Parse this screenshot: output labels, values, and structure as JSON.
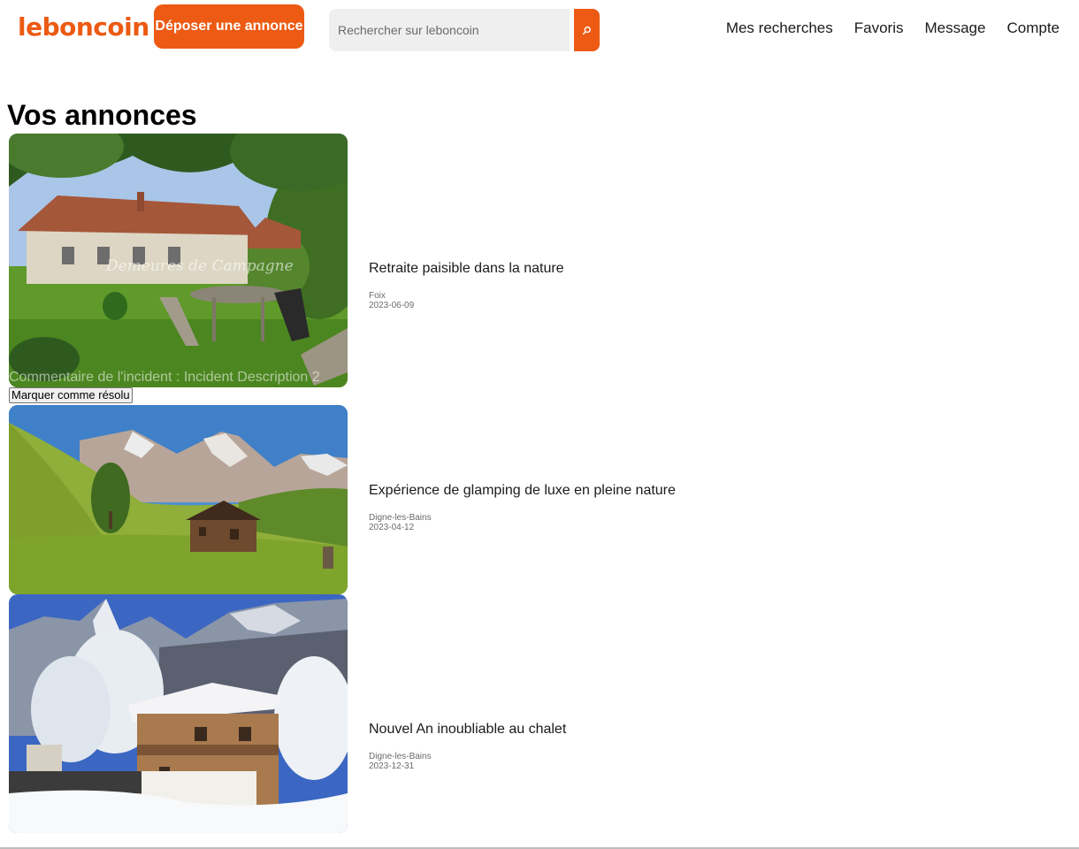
{
  "brand": {
    "logo_text": "leboncoin",
    "accent": "#ec5a13"
  },
  "header": {
    "post_button": "Déposer une annonce",
    "search": {
      "placeholder": "Rechercher sur leboncoin",
      "value": ""
    },
    "search_icon": "search-icon",
    "nav": [
      "Mes recherches",
      "Favoris",
      "Message",
      "Compte"
    ]
  },
  "main": {
    "title": "Vos annonces",
    "listings": [
      {
        "title": "Retraite paisible dans la nature",
        "location": "Foix",
        "date": "2023-06-09",
        "image": "country-house-garden",
        "watermark": "Demeures de Campagne",
        "incident_comment": "Commentaire de l'incident : Incident Description 2",
        "resolve_button": "Marquer comme résolu"
      },
      {
        "title": "Expérience de glamping de luxe en pleine nature",
        "location": "Digne-les-Bains",
        "date": "2023-04-12",
        "image": "mountain-cabin-meadow"
      },
      {
        "title": "Nouvel An inoubliable au chalet",
        "location": "Digne-les-Bains",
        "date": "2023-12-31",
        "image": "snowy-chalet"
      }
    ]
  }
}
